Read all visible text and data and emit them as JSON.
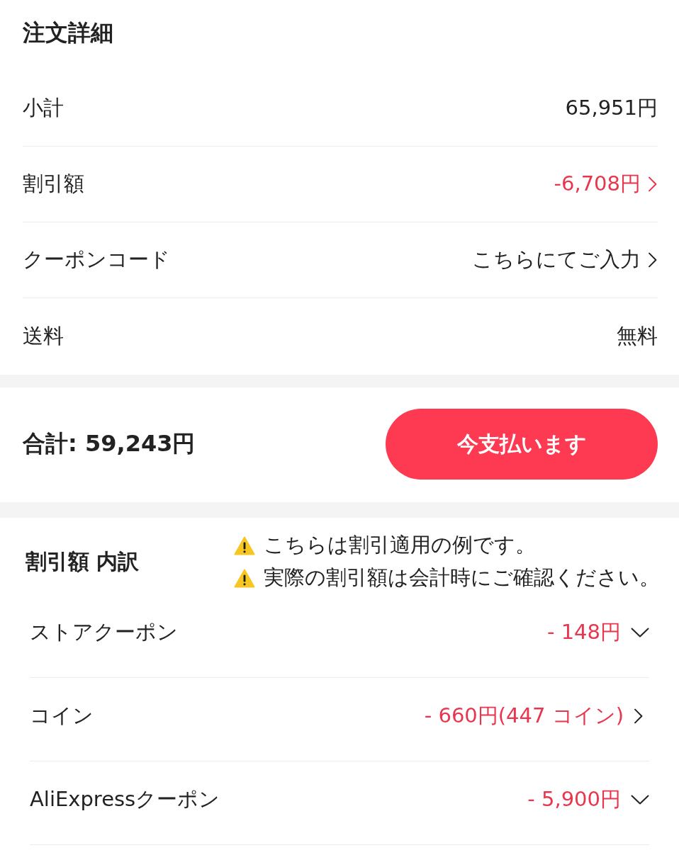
{
  "order_details": {
    "title": "注文詳細",
    "rows": [
      {
        "label": "小計",
        "value": "65,951円",
        "kind": "plain",
        "negative": false
      },
      {
        "label": "割引額",
        "value": "-6,708円",
        "kind": "link",
        "negative": true
      },
      {
        "label": "クーポンコード",
        "value": "こちらにてご入力",
        "kind": "link",
        "negative": false
      },
      {
        "label": "送料",
        "value": "無料",
        "kind": "plain",
        "negative": false
      }
    ]
  },
  "checkout": {
    "total": "合計: 59,243円",
    "pay_button": "今支払います"
  },
  "discount_breakdown": {
    "title": "割引額 内訳",
    "notices": [
      "こちらは割引適用の例です。",
      "実際の割引額は会計時にご確認ください。"
    ],
    "rows": [
      {
        "label": "ストアクーポン",
        "value": "- 148円",
        "kind": "dropdown",
        "negative": true
      },
      {
        "label": "コイン",
        "value": "- 660円(447 コイン)",
        "kind": "link",
        "negative": true
      },
      {
        "label": "AliExpressクーポン",
        "value": "- 5,900円",
        "kind": "dropdown",
        "negative": true
      }
    ]
  }
}
